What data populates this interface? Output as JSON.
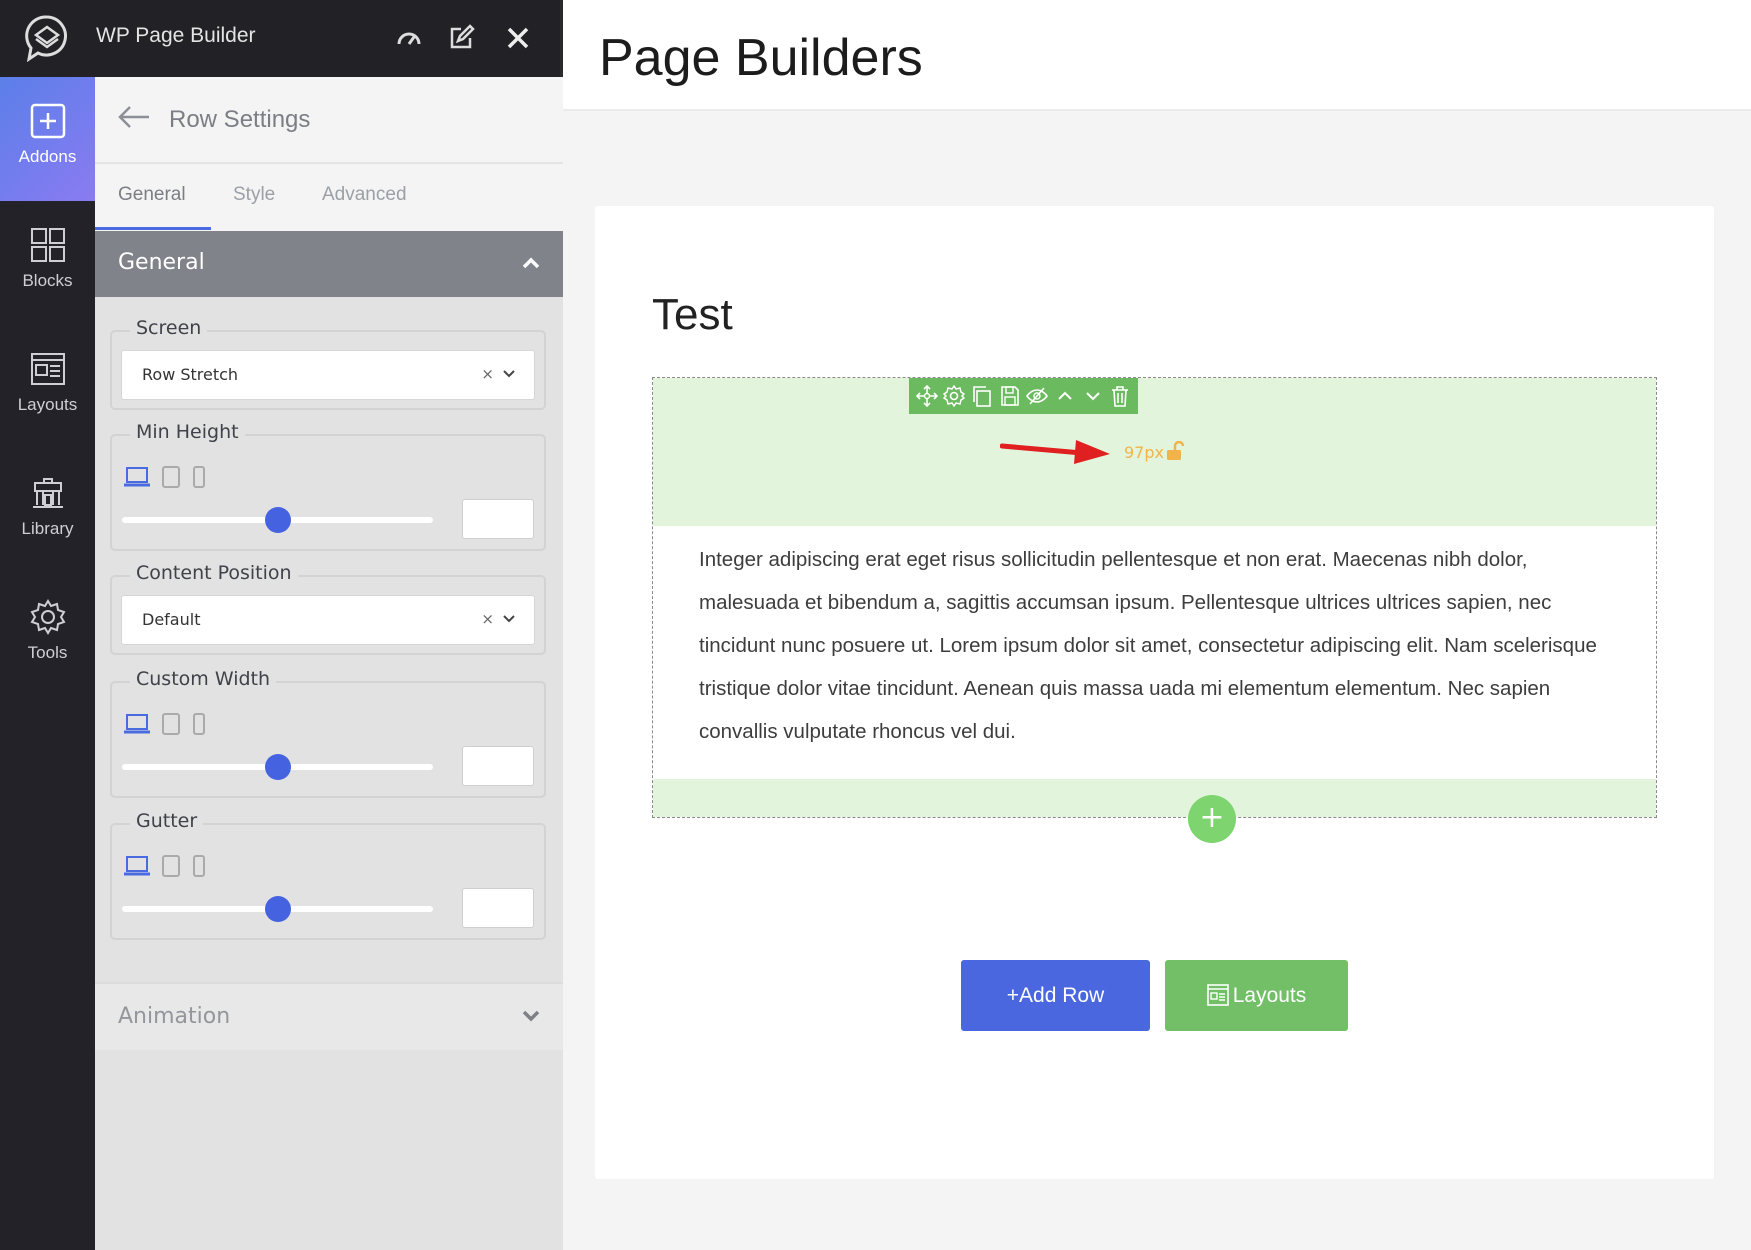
{
  "app": {
    "title": "WP Page Builder"
  },
  "topbar_icons": [
    "speedometer-icon",
    "edit-icon",
    "close-icon"
  ],
  "sidebar": {
    "items": [
      {
        "label": "Addons",
        "icon": "plus-square-icon",
        "active": true
      },
      {
        "label": "Blocks",
        "icon": "blocks-icon",
        "active": false
      },
      {
        "label": "Layouts",
        "icon": "layout-icon",
        "active": false
      },
      {
        "label": "Library",
        "icon": "library-icon",
        "active": false
      },
      {
        "label": "Tools",
        "icon": "gear-icon",
        "active": false
      }
    ]
  },
  "panel": {
    "title": "Row Settings",
    "tabs": [
      {
        "label": "General",
        "active": true
      },
      {
        "label": "Style",
        "active": false
      },
      {
        "label": "Advanced",
        "active": false
      }
    ],
    "section_general": "General",
    "fields": {
      "screen": {
        "label": "Screen",
        "value": "Row Stretch",
        "clear": "×"
      },
      "min_height": {
        "label": "Min Height",
        "slider_fraction": 0.5,
        "value": ""
      },
      "content_position": {
        "label": "Content Position",
        "value": "Default",
        "clear": "×"
      },
      "custom_width": {
        "label": "Custom Width",
        "slider_fraction": 0.5,
        "value": ""
      },
      "gutter": {
        "label": "Gutter",
        "slider_fraction": 0.5,
        "value": ""
      }
    },
    "section_animation": "Animation"
  },
  "canvas": {
    "page_title": "Page Builders",
    "card_title": "Test",
    "row": {
      "height_label": "97px",
      "text": "Integer adipiscing erat eget risus sollicitudin pellentesque et non erat. Maecenas nibh dolor, malesuada et bibendum a, sagittis accumsan ipsum. Pellentesque ultrices ultrices sapien, nec tincidunt nunc posuere ut. Lorem ipsum dolor sit amet, consectetur adipiscing elit. Nam scelerisque tristique dolor vitae tincidunt. Aenean quis massa uada mi elementum elementum. Nec sapien convallis vulputate rhoncus vel dui.",
      "add_symbol": "+"
    },
    "buttons": {
      "add_row": "+Add Row",
      "layouts": "Layouts"
    }
  },
  "colors": {
    "accent": "#4a67e0",
    "green": "#6cba5f",
    "row_bg": "#e2f5dc",
    "indicator": "#f0b44a"
  }
}
